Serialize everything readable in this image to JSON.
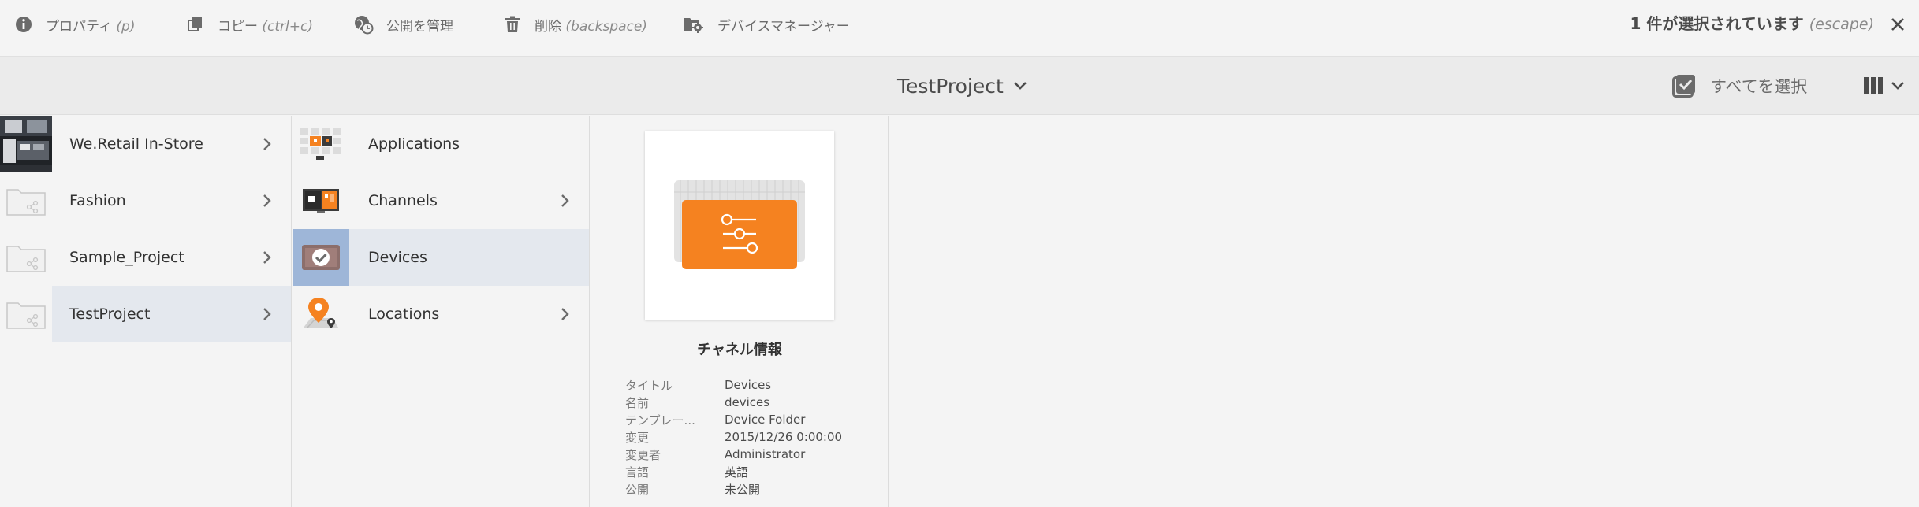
{
  "toolbar": {
    "properties": {
      "label": "プロパティ",
      "hint": "(p)",
      "icon": "info-icon"
    },
    "copy": {
      "label": "コピー",
      "hint": "(ctrl+c)",
      "icon": "copy-icon"
    },
    "manage_publication": {
      "label": "公開を管理",
      "icon": "globe-clock-icon"
    },
    "delete": {
      "label": "削除",
      "hint": "(backspace)",
      "icon": "trash-icon"
    },
    "device_manager": {
      "label": "デバイスマネージャー",
      "icon": "folder-gear-icon"
    },
    "selection_count": "1 件が選択されています",
    "selection_hint": "(escape)",
    "close_icon": "close-icon"
  },
  "titlebar": {
    "project_title": "TestProject",
    "select_all_label": "すべてを選択",
    "select_all_icon": "checkbox-checked-icon",
    "view_icon": "column-view-icon"
  },
  "columns": {
    "col1": [
      {
        "label": "We.Retail In-Store",
        "thumb": "store-photo",
        "has_children": true,
        "active": false
      },
      {
        "label": "Fashion",
        "thumb": "folder-share-icon",
        "has_children": true,
        "active": false
      },
      {
        "label": "Sample_Project",
        "thumb": "folder-share-icon",
        "has_children": true,
        "active": false
      },
      {
        "label": "TestProject",
        "thumb": "folder-share-icon",
        "has_children": true,
        "active": true
      }
    ],
    "col2": [
      {
        "label": "Applications",
        "thumb": "applications-grid-icon",
        "has_children": false,
        "active": false
      },
      {
        "label": "Channels",
        "thumb": "channels-icon",
        "has_children": true,
        "active": false
      },
      {
        "label": "Devices",
        "thumb": "devices-check-icon",
        "has_children": false,
        "active": true
      },
      {
        "label": "Locations",
        "thumb": "location-pin-icon",
        "has_children": true,
        "active": false
      }
    ]
  },
  "preview": {
    "title": "チャネル情報",
    "icon": "device-sliders-icon",
    "meta": [
      {
        "key": "タイトル",
        "value": "Devices"
      },
      {
        "key": "名前",
        "value": "devices"
      },
      {
        "key": "テンプレー...",
        "value": "Device Folder"
      },
      {
        "key": "変更",
        "value": "2015/12/26 0:00:00"
      },
      {
        "key": "変更者",
        "value": "Administrator"
      },
      {
        "key": "言語",
        "value": "英語"
      },
      {
        "key": "公開",
        "value": "未公開"
      }
    ]
  },
  "colors": {
    "accent_orange": "#f58220",
    "selection_blue": "#9eb6d8",
    "active_row": "#e4e8ee"
  }
}
